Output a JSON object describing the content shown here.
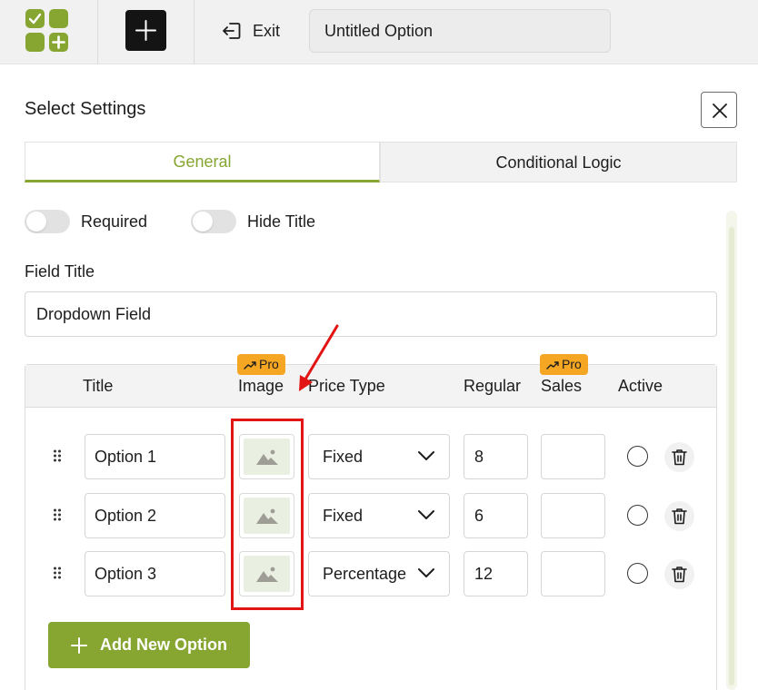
{
  "topbar": {
    "exit_label": "Exit",
    "option_title": "Untitled Option"
  },
  "dialog": {
    "heading": "Select Settings",
    "tabs": [
      {
        "label": "General",
        "active": true
      },
      {
        "label": "Conditional Logic",
        "active": false
      }
    ],
    "toggles": [
      {
        "label": "Required",
        "on": false
      },
      {
        "label": "Hide Title",
        "on": false
      }
    ],
    "field_title_label": "Field Title",
    "field_title_value": "Dropdown Field"
  },
  "table": {
    "headers": {
      "title": "Title",
      "image": "Image",
      "price_type": "Price Type",
      "regular": "Regular",
      "sales": "Sales",
      "active": "Active"
    },
    "pro_badge": "Pro",
    "rows": [
      {
        "title": "Option 1",
        "price_type": "Fixed",
        "regular": "8",
        "sales": ""
      },
      {
        "title": "Option 2",
        "price_type": "Fixed",
        "regular": "6",
        "sales": ""
      },
      {
        "title": "Option 3",
        "price_type": "Percentage",
        "regular": "12",
        "sales": ""
      }
    ],
    "add_button_label": "Add New Option"
  },
  "colors": {
    "accent": "#86a531",
    "pro_badge": "#f5a623",
    "annotation": "#e31414"
  },
  "icons": [
    "logo-icon",
    "plus-icon",
    "exit-icon",
    "close-icon",
    "drag-handle-icon",
    "image-placeholder-icon",
    "chevron-down-icon",
    "trash-icon",
    "trending-up-icon"
  ]
}
